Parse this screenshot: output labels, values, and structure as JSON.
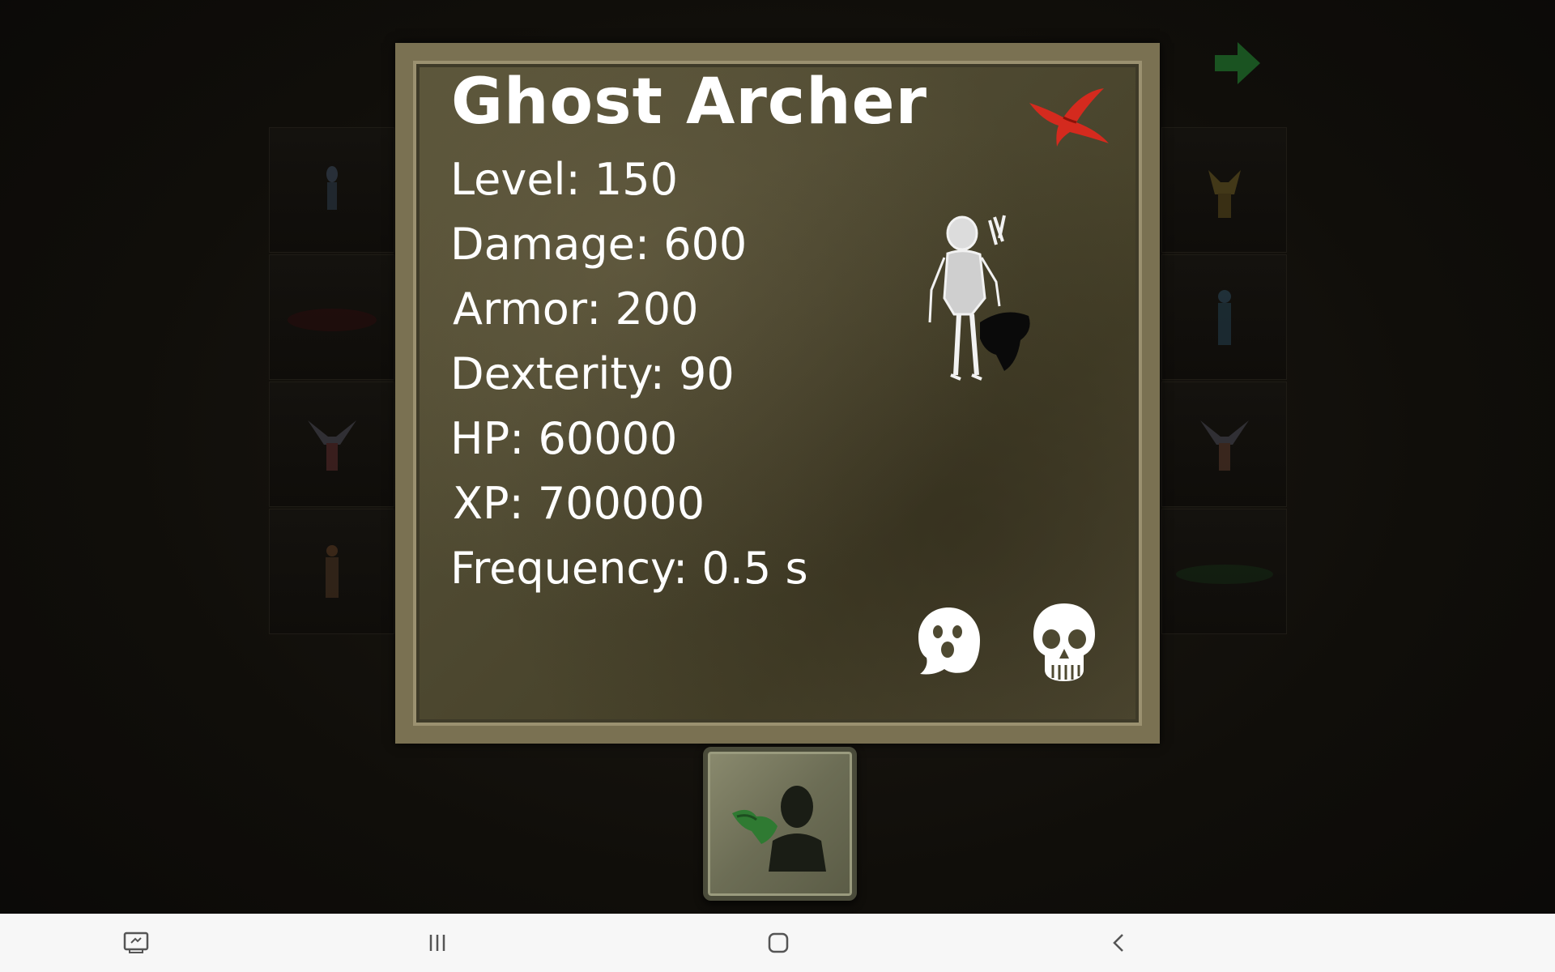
{
  "monster": {
    "name": "Ghost Archer",
    "stats": [
      {
        "label": "Level: 150"
      },
      {
        "label": "Damage: 600"
      },
      {
        "label": "Armor: 200"
      },
      {
        "label": "Dexterity: 90"
      },
      {
        "label": "HP: 60000"
      },
      {
        "label": "XP: 700000"
      },
      {
        "label": "Frequency: 0.5 s"
      }
    ],
    "traits": [
      "ghost-icon",
      "skull-icon"
    ]
  },
  "colors": {
    "close": "#d42a1e",
    "arrow": "#1f6b2a",
    "dialog_border": "#7a7152",
    "navbar": "#f7f7f7"
  },
  "icons": {
    "close": "close-icon",
    "next": "next-arrow-icon",
    "action": "character-swap-icon",
    "nav_recent": "screenshot-icon",
    "nav_menu": "recent-apps-icon",
    "nav_home": "home-icon",
    "nav_back": "back-icon"
  }
}
